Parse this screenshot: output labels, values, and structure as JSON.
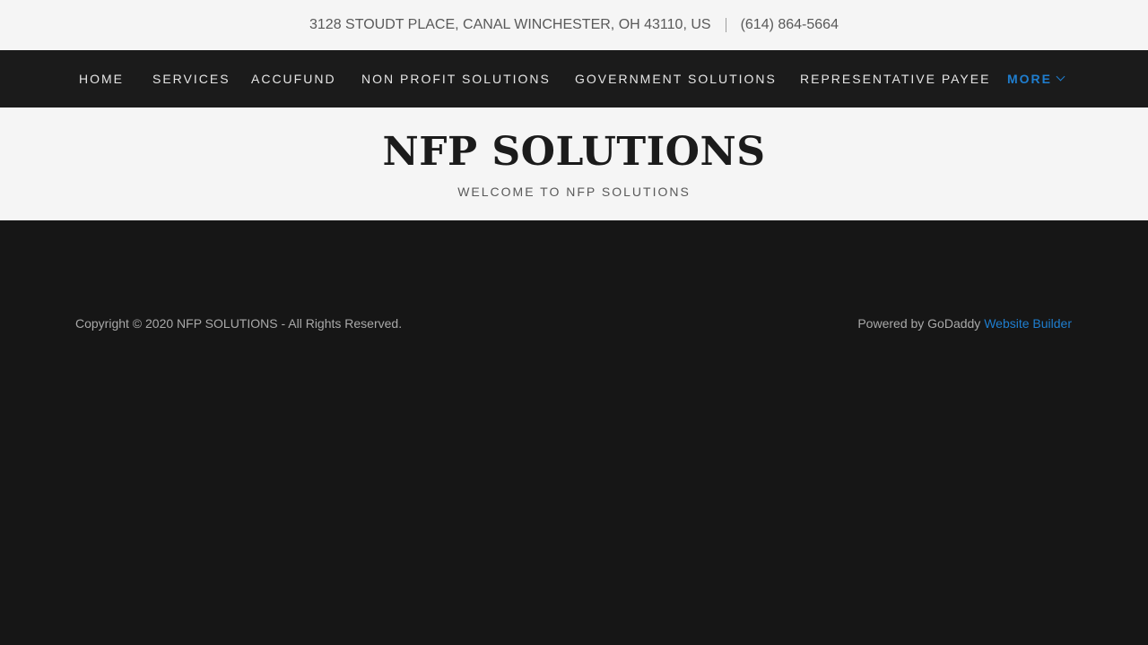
{
  "topbar": {
    "address": "3128 STOUDT PLACE, CANAL WINCHESTER, OH 43110, US",
    "phone": "(614) 864-5664"
  },
  "nav": {
    "items": [
      {
        "label": "HOME"
      },
      {
        "label": "SERVICES"
      },
      {
        "label": "ACCUFUND"
      },
      {
        "label": "NON PROFIT SOLUTIONS"
      },
      {
        "label": "GOVERNMENT SOLUTIONS"
      },
      {
        "label": "REPRESENTATIVE PAYEE"
      },
      {
        "label": "MORE"
      }
    ]
  },
  "hero": {
    "title": "NFP SOLUTIONS",
    "tagline": "WELCOME TO NFP SOLUTIONS"
  },
  "footer": {
    "copyright": "Copyright © 2020 NFP SOLUTIONS - All Rights Reserved.",
    "powered_prefix": "Powered by GoDaddy",
    "powered_link": "Website Builder"
  },
  "colors": {
    "accent": "#1f7ecf",
    "nav_bg": "#1b1b1b",
    "footer_bg": "#161616",
    "light_bg": "#f5f5f5"
  }
}
